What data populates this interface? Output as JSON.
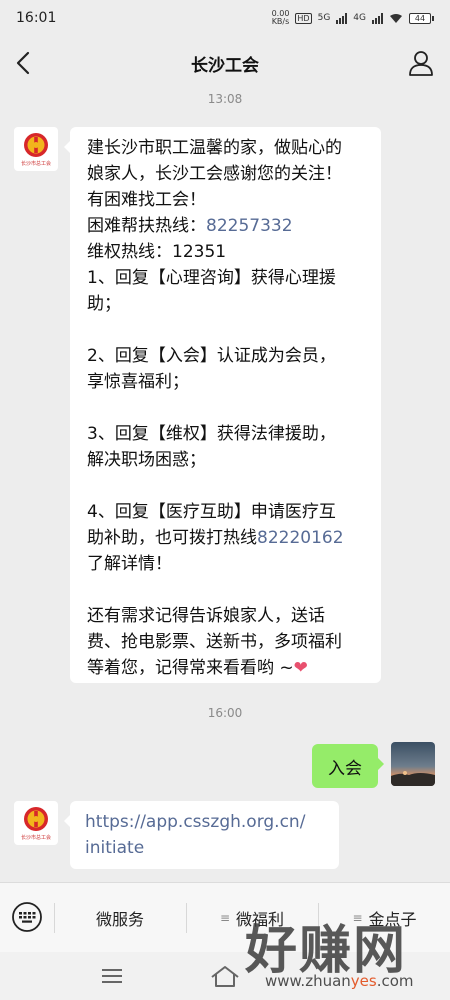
{
  "status_bar": {
    "time": "16:01",
    "net_speed_value": "0.00",
    "net_speed_unit": "KB/s",
    "hd_label": "HD",
    "network_5g": "5G",
    "network_4g": "4G",
    "battery": "44"
  },
  "nav": {
    "title": "长沙工会"
  },
  "timestamps": [
    "13:08",
    "16:00"
  ],
  "welcome_message": {
    "sender_logo_text": "长沙市总工会",
    "lines": [
      {
        "text": "建长沙市职工温馨的家，做贴心的"
      },
      {
        "text": "娘家人，长沙工会感谢您的关注！"
      },
      {
        "text": "有困难找工会！"
      },
      {
        "text": "困难帮扶热线：",
        "link": "82257332"
      },
      {
        "text": "维权热线：12351"
      },
      {
        "text": "1、回复【心理咨询】获得心理援"
      },
      {
        "text": "助；"
      },
      {
        "text": ""
      },
      {
        "text": "2、回复【入会】认证成为会员，"
      },
      {
        "text": "享惊喜福利；"
      },
      {
        "text": ""
      },
      {
        "text": "3、回复【维权】获得法律援助，"
      },
      {
        "text": "解决职场困惑；"
      },
      {
        "text": ""
      },
      {
        "text": "4、回复【医疗互助】申请医疗互"
      },
      {
        "text": "助补助，也可拨打热线",
        "link": "82220162"
      },
      {
        "text": "了解详情！"
      },
      {
        "text": ""
      },
      {
        "text": "还有需求记得告诉娘家人，送话"
      },
      {
        "text": "费、抢电影票、送新书，多项福利"
      },
      {
        "text": "等着您，记得常来看看哟 ~",
        "emoji": "❤"
      }
    ]
  },
  "user_message": {
    "text": "入会"
  },
  "reply_message": {
    "lines": [
      "https://app.csszgh.org.cn/",
      "initiate"
    ]
  },
  "bottom_menu": {
    "items": [
      "微服务",
      "微福利",
      "金点子"
    ],
    "menu_glyph": "≡"
  },
  "watermark": {
    "big": "好赚网",
    "small_prefix": "www.zhuan",
    "small_mid": "yes",
    "small_suffix": ".com"
  },
  "colors": {
    "background": "#ededed",
    "bubble_left": "#ffffff",
    "bubble_right": "#95ec69",
    "link": "#576b95",
    "logo_red": "#d7272a",
    "logo_yellow": "#f2b51c"
  }
}
